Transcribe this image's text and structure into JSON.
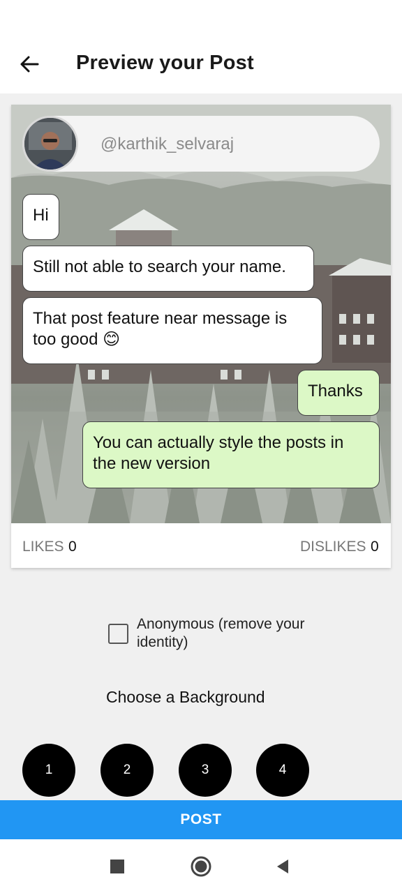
{
  "header": {
    "back_icon": "arrow-left-icon",
    "title": "Preview your Post"
  },
  "post": {
    "username": "@karthik_selvaraj",
    "messages": [
      {
        "type": "incoming",
        "text": "Hi"
      },
      {
        "type": "incoming",
        "text": "Still not able to search your name."
      },
      {
        "type": "incoming",
        "text": "That post feature near message is too good 😊"
      },
      {
        "type": "outgoing",
        "text": "Thanks"
      },
      {
        "type": "outgoing",
        "text": "You can actually style the posts in the new version"
      }
    ],
    "likes_label": "LIKES",
    "likes_count": "0",
    "dislikes_label": "DISLIKES",
    "dislikes_count": "0"
  },
  "options": {
    "anonymous_label": "Anonymous (remove your identity)",
    "anonymous_checked": false,
    "choose_background_label": "Choose a Background",
    "backgrounds": [
      "1",
      "2",
      "3",
      "4"
    ]
  },
  "actions": {
    "post_label": "POST"
  },
  "colors": {
    "primary": "#2196f3",
    "outgoing_bubble": "#dcf8c6",
    "incoming_bubble": "#ffffff"
  },
  "nav": {
    "icons": [
      "recents-square-icon",
      "home-circle-icon",
      "back-triangle-icon"
    ]
  }
}
